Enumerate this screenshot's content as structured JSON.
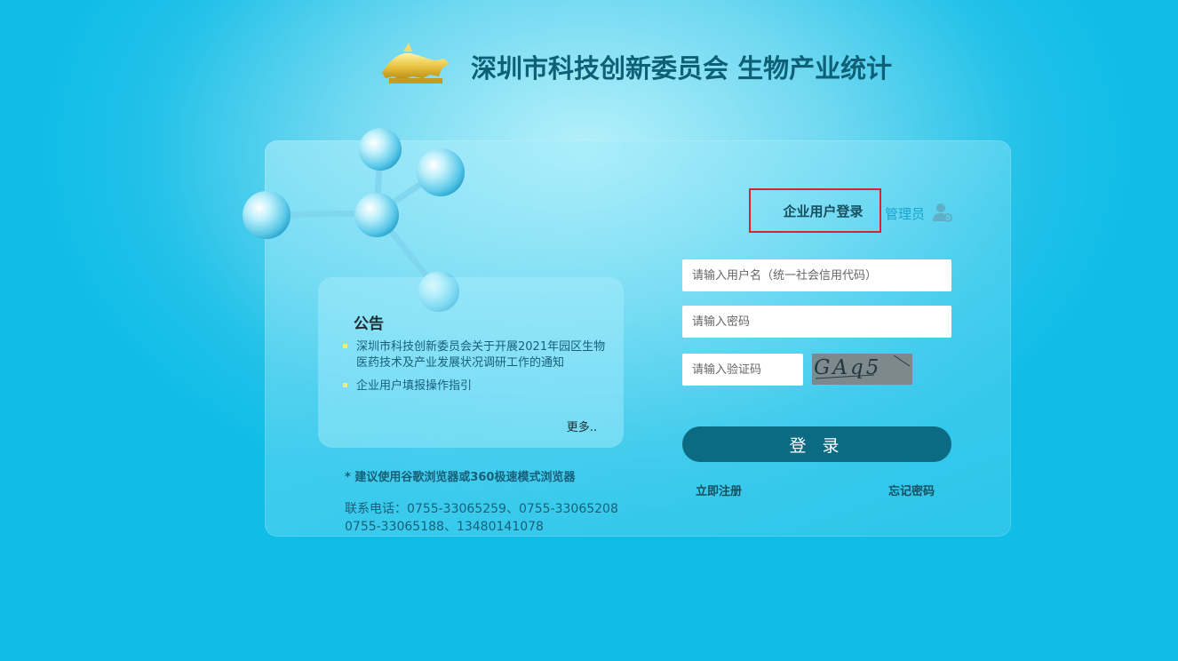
{
  "header": {
    "title": "深圳市科技创新委员会 生物产业统计"
  },
  "notice": {
    "title": "公告",
    "items": [
      {
        "text": "深圳市科技创新委员会关于开展2021年园区生物医药技术及产业发展状况调研工作的通知"
      },
      {
        "text": "企业用户填报操作指引"
      }
    ],
    "more_label": "更多.."
  },
  "browser_tip": "* 建议使用谷歌浏览器或360极速模式浏览器",
  "contact": {
    "line1": "联系电话：0755-33065259、0755-33065208",
    "line2": "0755-33065188、13480141078"
  },
  "login": {
    "tab_enterprise": "企业用户登录",
    "tab_admin": "管理员",
    "username_placeholder": "请输入用户名（统一社会信用代码）",
    "password_placeholder": "请输入密码",
    "captcha_placeholder": "请输入验证码",
    "captcha_text": "GAq5",
    "submit_label": "登 录",
    "register_label": "立即注册",
    "forgot_label": "忘记密码"
  },
  "colors": {
    "accent": "#0a6b83",
    "title": "#0e6077",
    "link": "#1aa5cf",
    "highlight_border": "#d9232d"
  },
  "icons": {
    "logo": "golden-bull-logo",
    "admin": "user-gear-icon",
    "bullet": "square-bullet"
  }
}
